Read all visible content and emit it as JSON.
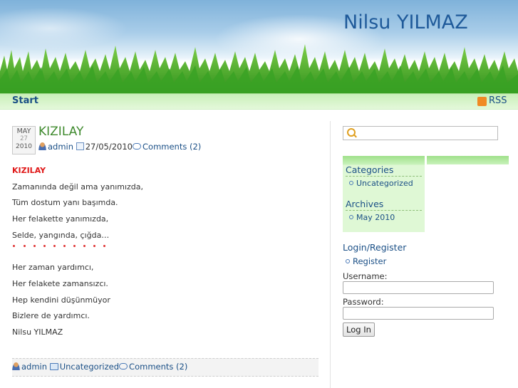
{
  "header": {
    "site_title": "Nilsu YILMAZ"
  },
  "nav": {
    "start": "Start",
    "rss": "RSS"
  },
  "post": {
    "date": {
      "month": "MAY",
      "day": "27",
      "year": "2010"
    },
    "title": "KIZILAY",
    "author": "admin",
    "date_text": "27/05/2010",
    "comments": "Comments (2)",
    "body": {
      "heading": "KIZILAY",
      "lines_1": [
        "Zamanında değil ama yanımızda,",
        "Tüm dostum yanı başımda.",
        "Her felakette yanımızda,",
        "Selde, yangında, çığda…"
      ],
      "lines_2": [
        "Her zaman yardımcı,",
        "Her felakete zamansızcı.",
        "Hep kendini düşünmüyor",
        "Bizlere de yardımcı.",
        "Nilsu YILMAZ"
      ]
    },
    "footer": {
      "author": "admin",
      "category": "Uncategorized",
      "comments": "Comments (2)"
    }
  },
  "sidebar": {
    "search_placeholder": "",
    "categories": {
      "title": "Categories",
      "items": [
        "Uncategorized"
      ]
    },
    "archives": {
      "title": "Archives",
      "items": [
        "May 2010"
      ]
    },
    "login": {
      "title": "Login/Register",
      "register": "Register",
      "username_label": "Username:",
      "password_label": "Password:",
      "button": "Log In"
    }
  },
  "colors": {
    "accent_link": "#1a4f86",
    "post_title": "#3f8a2e",
    "heading_red": "#e01818",
    "nav_green": "#c9efb9"
  },
  "icons": [
    "rss-icon",
    "user-icon",
    "calendar-icon",
    "comment-icon",
    "folder-icon",
    "search-icon",
    "bullet-icon"
  ]
}
